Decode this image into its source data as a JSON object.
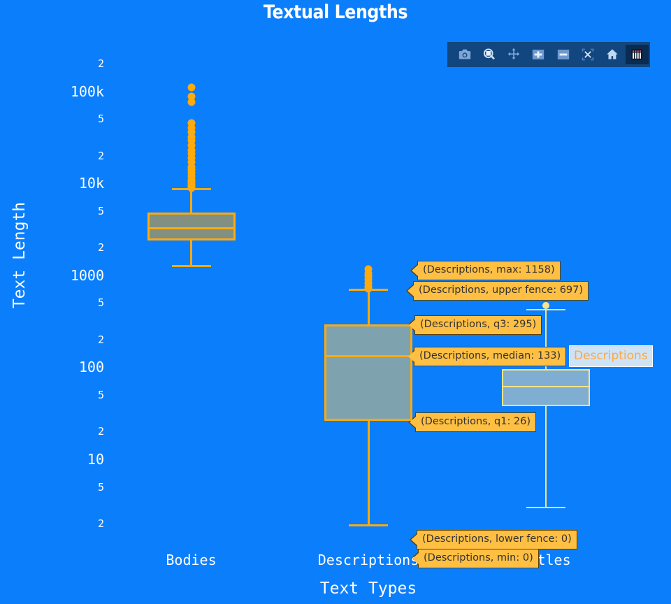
{
  "chart": {
    "title": "Textual Lengths",
    "xlabel": "Text Types",
    "ylabel": "Text Length"
  },
  "chart_data": {
    "type": "box",
    "title": "Textual Lengths",
    "xlabel": "Text Types",
    "ylabel": "Text Length",
    "yscale": "log",
    "ylim": [
      1.5,
      200000
    ],
    "grid": false,
    "legend": "none",
    "categories": [
      "Bodies",
      "Descriptions",
      "Titles"
    ],
    "series": [
      {
        "name": "Bodies",
        "color_fill": "#819081",
        "color_line": "#fcaa0e",
        "min": 1260,
        "lower_fence": 1260,
        "q1": 2370,
        "median": 3270,
        "q3": 4800,
        "upper_fence": 8600,
        "max": 110000,
        "outliers": [
          110000,
          88000,
          76000,
          45000,
          40000,
          36000,
          32000,
          29000,
          26000,
          23000,
          21000,
          19000,
          17000,
          15000,
          14000,
          13000,
          12000,
          11000,
          10500,
          10000,
          9600,
          9200,
          8900
        ]
      },
      {
        "name": "Descriptions",
        "color_fill": "#7ea2ae",
        "color_line": "#fcaa0e",
        "min": 0,
        "lower_fence": 0,
        "q1": 26,
        "median": 133,
        "q3": 295,
        "upper_fence": 697,
        "max": 1158,
        "outliers": [
          1158,
          1050,
          980,
          900,
          820,
          760,
          730,
          710
        ]
      },
      {
        "name": "Titles",
        "color_fill": "#80aed2",
        "color_line": "#fbe38a",
        "min": 3,
        "lower_fence": 3,
        "q1": 38,
        "median": 62,
        "q3": 96,
        "upper_fence": 420,
        "max": 620,
        "outliers": [
          620,
          470
        ]
      }
    ],
    "y_ticks": [
      {
        "value": 200000,
        "label": "2",
        "major": false
      },
      {
        "value": 100000,
        "label": "100k",
        "major": true
      },
      {
        "value": 50000,
        "label": "5",
        "major": false
      },
      {
        "value": 20000,
        "label": "2",
        "major": false
      },
      {
        "value": 10000,
        "label": "10k",
        "major": true
      },
      {
        "value": 5000,
        "label": "5",
        "major": false
      },
      {
        "value": 2000,
        "label": "2",
        "major": false
      },
      {
        "value": 1000,
        "label": "1000",
        "major": true
      },
      {
        "value": 500,
        "label": "5",
        "major": false
      },
      {
        "value": 200,
        "label": "2",
        "major": false
      },
      {
        "value": 100,
        "label": "100",
        "major": true
      },
      {
        "value": 50,
        "label": "5",
        "major": false
      },
      {
        "value": 20,
        "label": "2",
        "major": false
      },
      {
        "value": 10,
        "label": "10",
        "major": true
      },
      {
        "value": 5,
        "label": "5",
        "major": false
      },
      {
        "value": 2,
        "label": "2",
        "major": false
      }
    ],
    "annotations": [
      {
        "text": "(Descriptions, max: 1158)"
      },
      {
        "text": "(Descriptions, upper fence: 697)"
      },
      {
        "text": "(Descriptions, q3: 295)"
      },
      {
        "text": "(Descriptions, median: 133)"
      },
      {
        "text": "(Descriptions, q1: 26)"
      },
      {
        "text": "(Descriptions, lower fence: 0)"
      },
      {
        "text": "(Descriptions, min: 0)"
      }
    ],
    "hover_axis_label": "Descriptions",
    "colors": {
      "background": "#0b7efc",
      "text": "#ffffff",
      "annotation_fill": "#ffbf43",
      "annotation_text": "#333333",
      "hover_label_fill": "#cfe3f7",
      "hover_label_text": "#ffa83d"
    }
  },
  "modebar": {
    "buttons": [
      {
        "name": "download-plot-icon",
        "label": "Download plot as a png"
      },
      {
        "name": "zoom-icon",
        "label": "Zoom"
      },
      {
        "name": "pan-icon",
        "label": "Pan"
      },
      {
        "name": "zoom-in-icon",
        "label": "Zoom in"
      },
      {
        "name": "zoom-out-icon",
        "label": "Zoom out"
      },
      {
        "name": "autoscale-icon",
        "label": "Autoscale"
      },
      {
        "name": "reset-axes-icon",
        "label": "Reset axes"
      },
      {
        "name": "toggle-spike-lines-icon",
        "label": "Toggle Spike Lines"
      }
    ]
  },
  "y_tick_labels": [
    "2",
    "100k",
    "5",
    "2",
    "10k",
    "5",
    "2",
    "1000",
    "5",
    "2",
    "100",
    "5",
    "2",
    "10",
    "5",
    "2"
  ],
  "x_tick_labels": [
    "Bodies",
    "Descriptions",
    "Titles"
  ],
  "annotation_texts": [
    "(Descriptions, max: 1158)",
    "(Descriptions, upper fence: 697)",
    "(Descriptions, q3: 295)",
    "(Descriptions, median: 133)",
    "(Descriptions, q1: 26)",
    "(Descriptions, lower fence: 0)",
    "(Descriptions, min: 0)"
  ],
  "hover": {
    "label": "Descriptions"
  }
}
